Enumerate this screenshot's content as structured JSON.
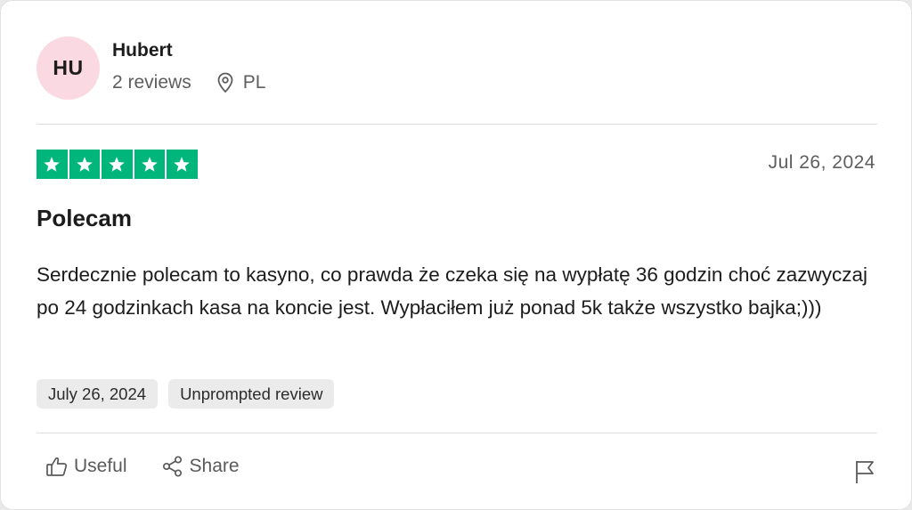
{
  "reviewer": {
    "initials": "HU",
    "name": "Hubert",
    "reviews_count": "2 reviews",
    "country": "PL",
    "avatar_color": "#fbd9e2"
  },
  "review": {
    "rating": 5,
    "star_color": "#00b67a",
    "date": "Jul 26, 2024",
    "title": "Polecam",
    "body": "Serdecznie polecam to kasyno, co prawda że czeka się na wypłatę 36 godzin choć zazwyczaj po 24 godzinkach kasa na koncie jest. Wypłaciłem już ponad 5k także wszystko bajka;)))",
    "tags": [
      "July 26, 2024",
      "Unprompted review"
    ]
  },
  "actions": {
    "useful_label": "Useful",
    "share_label": "Share",
    "icons": [
      "thumbs-up-icon",
      "share-icon",
      "flag-icon"
    ]
  }
}
